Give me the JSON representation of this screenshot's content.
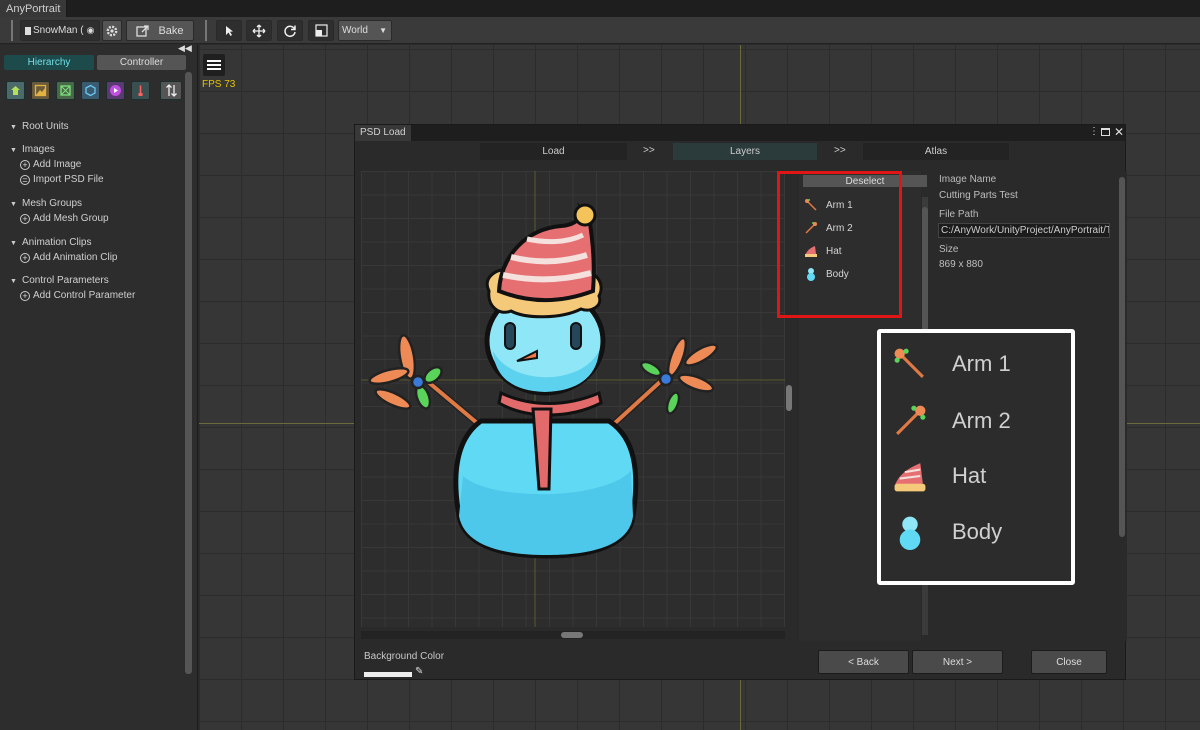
{
  "app": {
    "tab_label": "AnyPortrait"
  },
  "toolbar": {
    "mesh_select": "SnowMan (",
    "bake_label": "Bake",
    "space_select": "World"
  },
  "left_panel": {
    "tabs": {
      "hierarchy": "Hierarchy",
      "controller": "Controller"
    },
    "tree": {
      "root_units": "Root Units",
      "images": "Images",
      "add_image": "Add Image",
      "import_psd": "Import PSD File",
      "mesh_groups": "Mesh Groups",
      "add_mesh_group": "Add Mesh Group",
      "animation_clips": "Animation Clips",
      "add_animation_clip": "Add Animation Clip",
      "control_parameters": "Control Parameters",
      "add_control_parameter": "Add Control Parameter"
    }
  },
  "viewport": {
    "fps": "FPS 73"
  },
  "dialog": {
    "tab_title": "PSD Load",
    "steps": {
      "load": "Load",
      "arrow": ">>",
      "layers": "Layers",
      "atlas": "Atlas"
    },
    "deselect_label": "Deselect",
    "layers": [
      "Arm 1",
      "Arm 2",
      "Hat",
      "Body"
    ],
    "info": {
      "image_name_label": "Image Name",
      "image_name_value": "Cutting Parts Test",
      "file_path_label": "File Path",
      "file_path_value": "C:/AnyWork/UnityProject/AnyPortrait/T",
      "size_label": "Size",
      "size_value": "869 x 880"
    },
    "background_color_label": "Background Color",
    "buttons": {
      "back": "< Back",
      "next": "Next >",
      "close": "Close"
    }
  },
  "zoom_callout": {
    "layers": [
      "Arm 1",
      "Arm 2",
      "Hat",
      "Body"
    ]
  },
  "colors": {
    "highlight_red": "#e01515",
    "hierarchy_accent": "#6fe0e6",
    "fps_yellow": "#e3c400"
  }
}
